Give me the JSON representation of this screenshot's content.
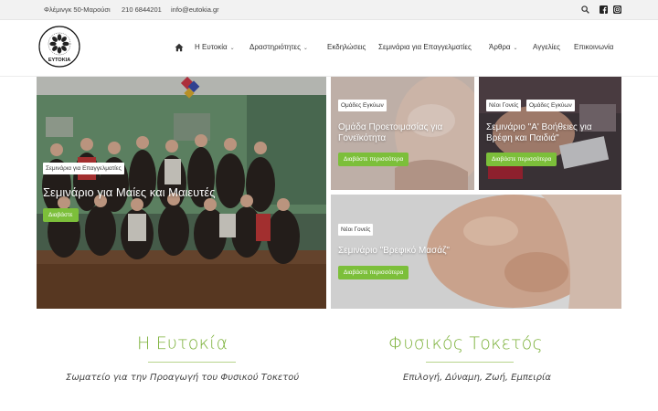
{
  "topbar": {
    "address": "Φλέμινγκ 50-Μαρούσι",
    "phone": "210 6844201",
    "email": "info@eutokia.gr"
  },
  "header": {
    "logo_text": "ΕΥΤΟΚΙΑ",
    "nav": [
      {
        "label": "Η Ευτοκία",
        "has_dropdown": true
      },
      {
        "label": "Δραστηριότητες",
        "has_dropdown": true
      },
      {
        "label": "Εκδηλώσεις",
        "has_dropdown": false
      },
      {
        "label": "Σεμινάρια για Επαγγελματίες",
        "has_dropdown": false
      },
      {
        "label": "Άρθρα",
        "has_dropdown": true
      },
      {
        "label": "Αγγελίες",
        "has_dropdown": false
      },
      {
        "label": "Επικοινωνία",
        "has_dropdown": false
      }
    ]
  },
  "tiles": {
    "main": {
      "badge": "Σεμινάρια για Επαγγελματίες",
      "title": "Σεμινάριο για Μαίες και Μαιευτές",
      "button": "Διαβάστε"
    },
    "t1": {
      "badge": "Ομάδες Εγκύων",
      "title_1": "Ομάδα Προετοιμασίας για",
      "title_2": "Γονεϊκότητα",
      "button": "Διαβάστε περισσότερα"
    },
    "t2": {
      "badge_1": "Νέοι Γονείς",
      "badge_2": "Ομάδες Εγκύων",
      "title_1": "Σεμινάριο \"Α' Βοήθειες για",
      "title_2": "Βρέφη και Παιδιά\"",
      "button": "Διαβάστε περισσότερα"
    },
    "t3": {
      "badge": "Νέοι Γονείς",
      "title": "Σεμινάριο \"Βρεφικό Μασάζ\"",
      "button": "Διαβάστε περισσότερα"
    }
  },
  "sections": {
    "left": {
      "title": "Η Ευτοκία",
      "subtitle": "Σωματείο για την Προαγωγή του Φυσικού Τοκετού"
    },
    "right": {
      "title": "Φυσικός Τοκετός",
      "subtitle": "Επιλογή, Δύναμη, Ζωή, Εμπειρία"
    }
  },
  "colors": {
    "accent": "#7cbf3a",
    "title_green": "#7cb13a"
  }
}
